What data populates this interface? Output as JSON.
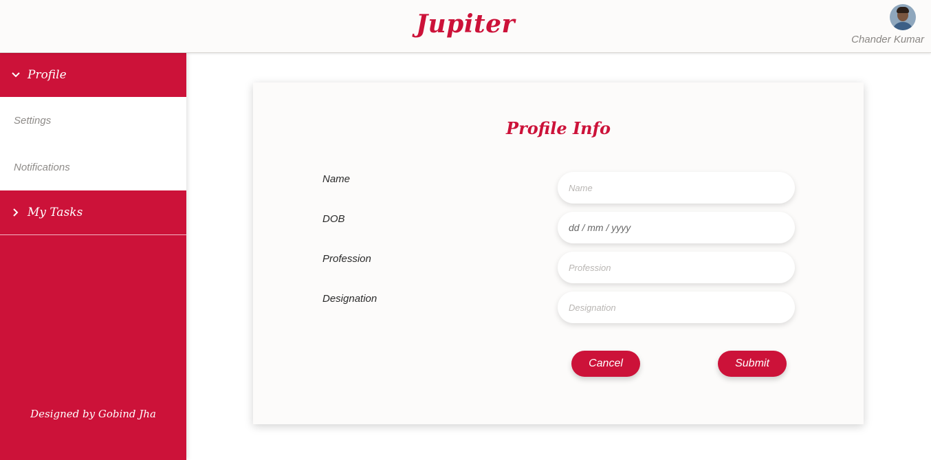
{
  "app": {
    "brand": "Jupiter",
    "user_name": "Chander Kumar",
    "accent_color": "#cc1239"
  },
  "sidebar": {
    "sections": [
      {
        "label": "Profile",
        "icon": "chevron-down-icon",
        "expanded": true,
        "items": [
          {
            "label": "Settings"
          },
          {
            "label": "Notifications"
          }
        ]
      },
      {
        "label": "My Tasks",
        "icon": "chevron-right-icon",
        "expanded": false
      }
    ],
    "footer": "Designed by Gobind Jha"
  },
  "form": {
    "title": "Profile Info",
    "fields": [
      {
        "label": "Name",
        "placeholder": "Name",
        "type": "text"
      },
      {
        "label": "DOB",
        "placeholder": "dd / mm / yyyy",
        "type": "date"
      },
      {
        "label": "Profession",
        "placeholder": "Profession",
        "type": "text"
      },
      {
        "label": "Designation",
        "placeholder": "Designation",
        "type": "text"
      }
    ],
    "cancel_label": "Cancel",
    "submit_label": "Submit"
  }
}
